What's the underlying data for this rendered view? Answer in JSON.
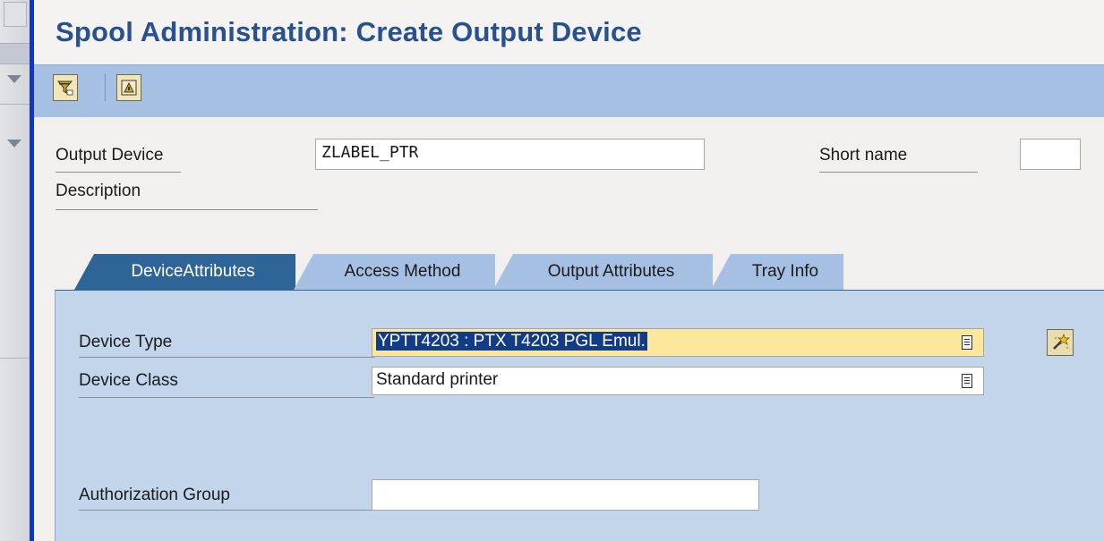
{
  "window": {
    "title": "Spool Administration: Create Output Device"
  },
  "toolbar": {
    "buttons": [
      {
        "icon": "filter-choose-icon"
      },
      {
        "icon": "test-print-icon"
      }
    ]
  },
  "header_fields": {
    "output_device": {
      "label": "Output Device",
      "value": "ZLABEL_PTR"
    },
    "short_name": {
      "label": "Short name",
      "value": ""
    },
    "description": {
      "label": "Description"
    }
  },
  "tabs": [
    {
      "label": "DeviceAttributes",
      "active": true
    },
    {
      "label": "Access Method",
      "active": false
    },
    {
      "label": "Output Attributes",
      "active": false
    },
    {
      "label": "Tray Info",
      "active": false
    }
  ],
  "device_attributes": {
    "device_type": {
      "label": "Device Type",
      "value": "YPTT4203 : PTX T4203 PGL Emul."
    },
    "device_class": {
      "label": "Device Class",
      "value": "Standard printer"
    },
    "authorization_group": {
      "label": "Authorization Group",
      "value": ""
    }
  },
  "colors": {
    "title": "#27528f",
    "toolbar": "#a6c0e4",
    "active_tab": "#2f6497",
    "panel": "#c2d5ea",
    "accent_bar": "#1136c6",
    "highlight_field": "#fbe89d"
  }
}
